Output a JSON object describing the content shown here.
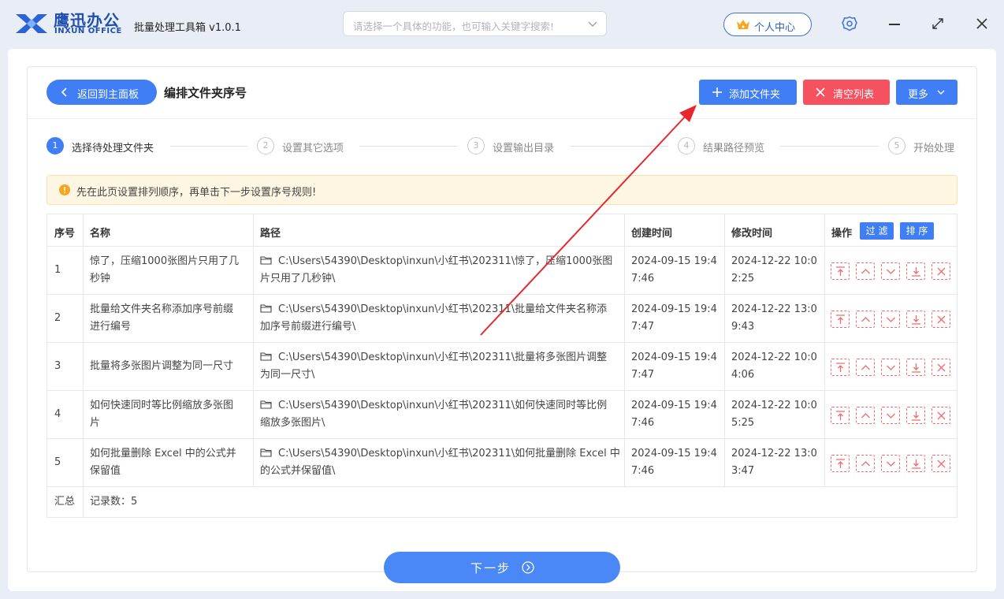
{
  "app": {
    "logo_cn": "鹰迅办公",
    "logo_en": "INXUN OFFICE",
    "title": "批量处理工具箱 v1.0.1",
    "search_placeholder": "请选择一个具体的功能，也可输入关键字搜索!",
    "user_center": "个人中心"
  },
  "header": {
    "back_label": "返回到主面板",
    "page_title": "编排文件夹序号",
    "add_folder": "添加文件夹",
    "clear_list": "清空列表",
    "more": "更多"
  },
  "steps": [
    {
      "num": "1",
      "label": "选择待处理文件夹"
    },
    {
      "num": "2",
      "label": "设置其它选项"
    },
    {
      "num": "3",
      "label": "设置输出目录"
    },
    {
      "num": "4",
      "label": "结果路径预览"
    },
    {
      "num": "5",
      "label": "开始处理"
    }
  ],
  "notice": "先在此页设置排列顺序，再单击下一步设置序号规则!",
  "table": {
    "headers": {
      "index": "序号",
      "name": "名称",
      "path": "路径",
      "created": "创建时间",
      "modified": "修改时间",
      "ops": "操作",
      "filter": "过 滤",
      "sort": "排 序"
    },
    "rows": [
      {
        "index": "1",
        "name1": "惊了，压缩1000张图片只用了几",
        "name2": "秒钟",
        "path1": "C:\\Users\\54390\\Desktop\\inxun\\小红书\\202311\\惊了，压缩1000张图",
        "path2": "片只用了几秒钟\\",
        "c1": "2024-09-15 19:4",
        "c2": "7:46",
        "m1": "2024-12-22 10:0",
        "m2": "2:25"
      },
      {
        "index": "2",
        "name1": "批量给文件夹名称添加序号前缀",
        "name2": "进行编号",
        "path1": "C:\\Users\\54390\\Desktop\\inxun\\小红书\\202311\\批量给文件夹名称添",
        "path2": "加序号前缀进行编号\\",
        "c1": "2024-09-15 19:4",
        "c2": "7:47",
        "m1": "2024-12-22 13:0",
        "m2": "9:43"
      },
      {
        "index": "3",
        "name1": "批量将多张图片调整为同一尺寸",
        "name2": "",
        "path1": "C:\\Users\\54390\\Desktop\\inxun\\小红书\\202311\\批量将多张图片调整",
        "path2": "为同一尺寸\\",
        "c1": "2024-09-15 19:4",
        "c2": "7:47",
        "m1": "2024-12-22 10:0",
        "m2": "4:06"
      },
      {
        "index": "4",
        "name1": "如何快速同时等比例缩放多张图",
        "name2": "片",
        "path1": "C:\\Users\\54390\\Desktop\\inxun\\小红书\\202311\\如何快速同时等比例",
        "path2": "缩放多张图片\\",
        "c1": "2024-09-15 19:4",
        "c2": "7:46",
        "m1": "2024-12-22 10:0",
        "m2": "5:25"
      },
      {
        "index": "5",
        "name1": "如何批量删除 Excel 中的公式并",
        "name2": "保留值",
        "path1": "C:\\Users\\54390\\Desktop\\inxun\\小红书\\202311\\如何批量删除 Excel 中",
        "path2": "的公式并保留值\\",
        "c1": "2024-09-15 19:4",
        "c2": "7:46",
        "m1": "2024-12-22 13:0",
        "m2": "3:47"
      }
    ],
    "summary_label": "汇总",
    "summary_value": "记录数：5"
  },
  "next_label": "下一步",
  "colors": {
    "primary": "#3f7ef5",
    "danger": "#f5515f",
    "annotation": "#e8262b"
  }
}
